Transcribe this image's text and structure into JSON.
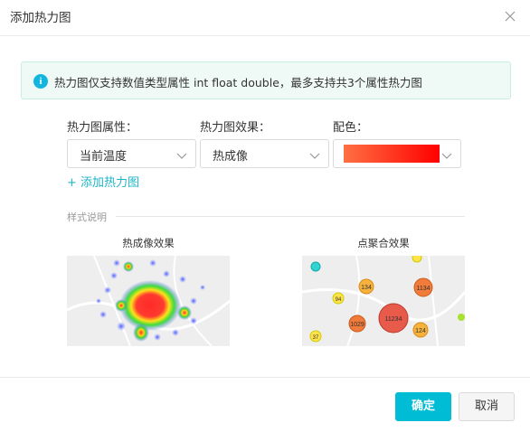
{
  "dialog": {
    "title": "添加热力图",
    "close_icon": "close-icon"
  },
  "notice": {
    "icon": "info-icon",
    "icon_glyph": "i",
    "text": "热力图仅支持数值类型属性 int float double，最多支持共3个属性热力图"
  },
  "form": {
    "attribute_label": "热力图属性：",
    "effect_label": "热力图效果：",
    "color_label": "配色：",
    "attribute_value": "当前温度",
    "effect_value": "热成像",
    "color_gradient": [
      "#ff7043",
      "#ff0000"
    ],
    "add_link": "+ 添加热力图"
  },
  "style_section": {
    "label": "样式说明",
    "thermal_caption": "热成像效果",
    "cluster_caption": "点聚合效果",
    "cluster_labels": [
      "134",
      "1134",
      "94",
      "1029",
      "11234",
      "124",
      "37"
    ]
  },
  "footer": {
    "ok_label": "确定",
    "cancel_label": "取消"
  }
}
